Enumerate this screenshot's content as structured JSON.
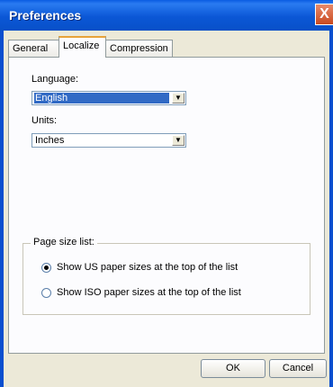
{
  "window": {
    "title": "Preferences",
    "close_glyph": "X"
  },
  "tabs": [
    {
      "label": "General"
    },
    {
      "label": "Localize",
      "active": true
    },
    {
      "label": "Compression"
    }
  ],
  "localize": {
    "language_label": "Language:",
    "language_value": "English",
    "units_label": "Units:",
    "units_value": "Inches"
  },
  "page_size": {
    "group_label": "Page size list:",
    "options": [
      {
        "label": "Show US paper sizes at the top of the list",
        "checked": true
      },
      {
        "label": "Show ISO paper sizes at the top of the list",
        "checked": false
      }
    ]
  },
  "buttons": {
    "ok": "OK",
    "cancel": "Cancel"
  },
  "icons": {
    "dropdown": "dropdown-arrow-icon",
    "close": "close-icon"
  },
  "colors": {
    "titlebar": "#0a5ce2",
    "selection": "#316ac5",
    "close": "#c94a1f"
  }
}
